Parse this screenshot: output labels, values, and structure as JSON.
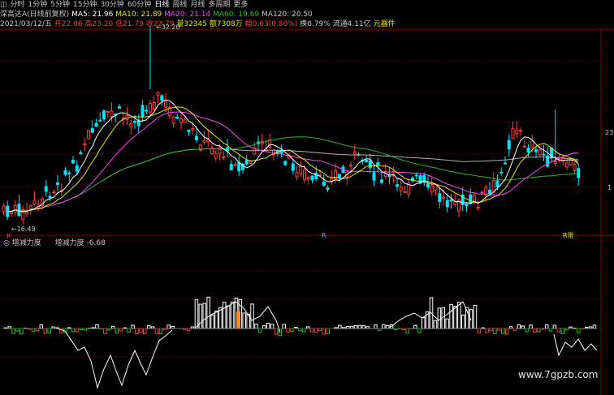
{
  "toolbar": {
    "items": [
      {
        "label": "◫",
        "selected": false
      },
      {
        "label": "分时",
        "selected": false
      },
      {
        "label": "1分钟",
        "selected": false
      },
      {
        "label": "5分钟",
        "selected": false
      },
      {
        "label": "15分钟",
        "selected": false
      },
      {
        "label": "30分钟",
        "selected": false
      },
      {
        "label": "60分钟",
        "selected": false
      },
      {
        "label": "日线",
        "selected": true
      },
      {
        "label": "周线",
        "selected": false
      },
      {
        "label": "月线",
        "selected": false
      },
      {
        "label": "多周期",
        "selected": false
      },
      {
        "label": "更多",
        "selected": false
      }
    ]
  },
  "ma_line": {
    "title": "深高达A(日线前复权)",
    "ma5": "MA5: 21.96",
    "ma10": "MA10: 21.89",
    "ma20": "MA20: 21.14",
    "ma60": "MA60: 19.69",
    "ma120": "MA120: 20.50"
  },
  "info_line": {
    "date": "2021/03/12/五",
    "open": "开22.06",
    "high": "高23.20",
    "low": "低21.79",
    "close": "收22.79",
    "volume": "量32345",
    "amount": "额7308万",
    "change": "幅0.63(0.80%)",
    "turnover": "换0.79%",
    "float": "流通4.11亿",
    "tail": "元器件"
  },
  "price_labels": {
    "high_marker": "32.20",
    "low_marker": "16.49",
    "right_price": "23",
    "right_price2": "1"
  },
  "indicator": {
    "name": "增减力度",
    "label": "增减力度",
    "value": "-6.68"
  },
  "markers": {
    "m1": "R",
    "m2": "R",
    "m3": "R限"
  },
  "watermark": "www.7gpzb.com",
  "colors": {
    "up": "#ff3c3c",
    "down": "#00e5ff",
    "ma5": "#ffffff",
    "ma10": "#e8e800",
    "ma20": "#ff40ff",
    "ma60": "#20c020",
    "ma120": "#b0b0b0",
    "gridline": "#8b0000"
  }
}
